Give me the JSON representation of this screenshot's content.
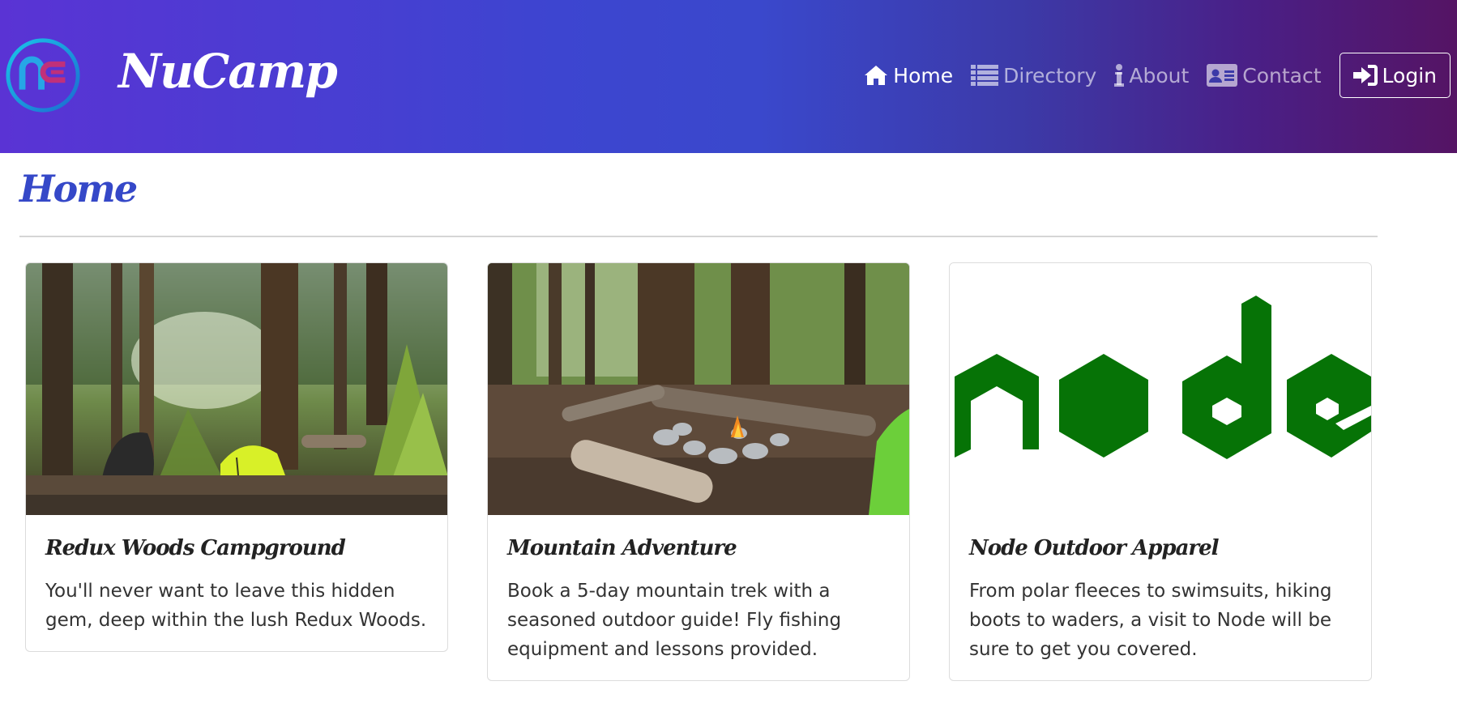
{
  "navbar": {
    "brand": "NuCamp",
    "items": [
      {
        "label": "Home",
        "icon": "home-icon",
        "active": true
      },
      {
        "label": "Directory",
        "icon": "list-icon",
        "active": false
      },
      {
        "label": "About",
        "icon": "info-icon",
        "active": false
      },
      {
        "label": "Contact",
        "icon": "address-card-icon",
        "active": false
      }
    ],
    "login_label": "Login",
    "login_icon": "sign-in-icon"
  },
  "page": {
    "title": "Home"
  },
  "cards": [
    {
      "title": "Redux Woods Campground",
      "text": "You'll never want to leave this hidden gem, deep within the lush Redux Woods.",
      "image": "forest campsite with yellow tent"
    },
    {
      "title": "Mountain Adventure",
      "text": "Book a 5-day mountain trek with a seasoned outdoor guide! Fly fishing equipment and lessons provided.",
      "image": "campfire ring with logs in forest"
    },
    {
      "title": "Node Outdoor Apparel",
      "text": "From polar fleeces to swimsuits, hiking boots to waders, a visit to Node will be sure to get you covered.",
      "image": "node logo"
    }
  ],
  "colors": {
    "title_blue": "#3548c8",
    "node_green": "#067306"
  }
}
